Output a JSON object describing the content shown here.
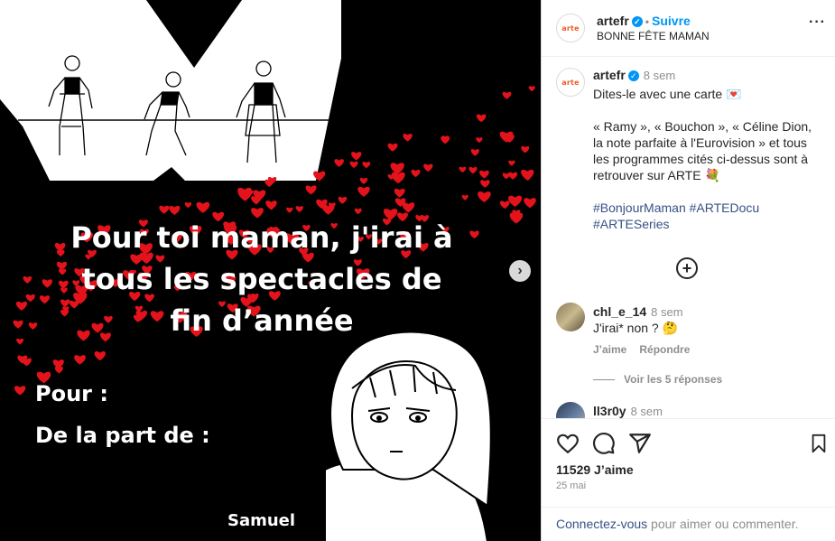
{
  "media": {
    "caption_line1": "Pour toi maman, j'irai à",
    "caption_line2": "tous les spectacles de",
    "caption_line3": "fin d’année",
    "pour_label": "Pour :",
    "from_label": "De la part de :",
    "signature": "Samuel",
    "next_icon": "chevron-right-icon"
  },
  "header": {
    "username": "artefr",
    "verified_icon": "verified-badge-icon",
    "separator": "•",
    "follow_label": "Suivre",
    "subtitle": "BONNE FÊTE MAMAN",
    "more_icon": "more-options-icon",
    "avatar_text": "arte"
  },
  "post": {
    "username": "artefr",
    "time": "8 sem",
    "line1": "Dites-le avec une carte 💌",
    "paragraph2": "« Ramy », « Bouchon », « Céline Dion, la note parfaite à l'Eurovision » et tous les programmes cités ci-dessus sont à retrouver sur ARTE 💐",
    "hashtags_line1": "#BonjourMaman #ARTEDocu",
    "hashtags_line2": "#ARTESeries",
    "load_more_icon": "plus-circle-icon"
  },
  "comments": [
    {
      "username": "chl_e_14",
      "time": "8 sem",
      "text": "J'irai* non ? 🤔",
      "like_label": "J’aime",
      "reply_label": "Répondre",
      "view_replies": "Voir les 5 réponses"
    },
    {
      "username": "ll3r0y",
      "time": "8 sem"
    }
  ],
  "footer": {
    "likes": "11529 J’aime",
    "date": "25 mai",
    "login_link": "Connectez-vous",
    "login_rest": " pour aimer ou commenter.",
    "icons": [
      "heart-icon",
      "comment-icon",
      "share-icon",
      "bookmark-icon"
    ]
  },
  "colors": {
    "accent": "#0095f6",
    "link": "#385185",
    "hearts": "#e3121b",
    "arte": "#f05a28"
  }
}
